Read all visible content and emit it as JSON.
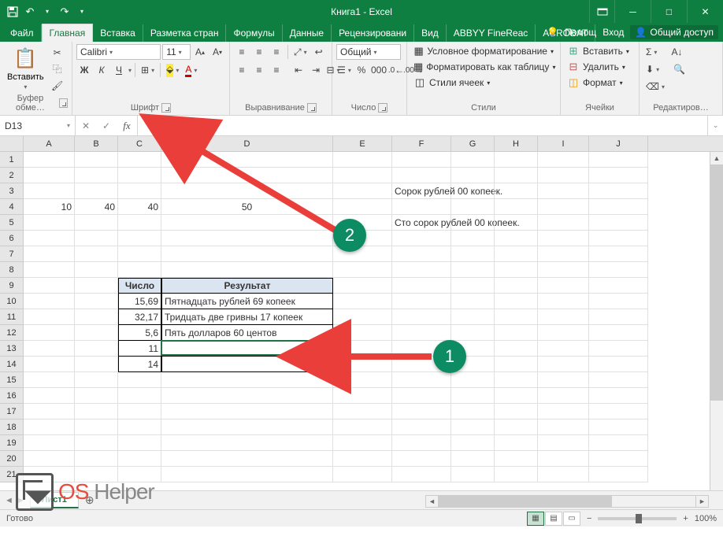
{
  "title": "Книга1 - Excel",
  "qat": {
    "save": "💾",
    "undo": "↶",
    "redo": "↷"
  },
  "tabs": {
    "file": "Файл",
    "list": [
      "Главная",
      "Вставка",
      "Разметка стран",
      "Формулы",
      "Данные",
      "Рецензировани",
      "Вид",
      "ABBYY FineReac",
      "ACROBAT"
    ],
    "active": 0,
    "tell_me": "Помощ",
    "signin": "Вход",
    "share": "Общий доступ"
  },
  "ribbon": {
    "clipboard": {
      "paste": "Вставить",
      "label": "Буфер обме…"
    },
    "font": {
      "name": "Calibri",
      "size": "11",
      "bold": "Ж",
      "italic": "К",
      "underline": "Ч",
      "label": "Шрифт"
    },
    "alignment": {
      "label": "Выравнивание"
    },
    "number": {
      "format": "Общий",
      "label": "Число"
    },
    "styles": {
      "cond": "Условное форматирование",
      "table": "Форматировать как таблицу",
      "cell": "Стили ячеек",
      "label": "Стили"
    },
    "cells": {
      "insert": "Вставить",
      "delete": "Удалить",
      "format": "Формат",
      "label": "Ячейки"
    },
    "editing": {
      "label": "Редактиров…"
    }
  },
  "name_box": "D13",
  "formula": "",
  "columns": [
    "A",
    "B",
    "C",
    "D",
    "E",
    "F",
    "G",
    "H",
    "I",
    "J"
  ],
  "cells": {
    "F3": "Сорок рублей  00 копеек.",
    "A4": "10",
    "B4": "40",
    "C4": "40",
    "D4": "50",
    "F5": "Сто сорок рублей  00 копеек.",
    "C9": "Число",
    "D9": "Результат",
    "C10": "15,69",
    "D10": "Пятнадцать рублей 69 копеек",
    "C11": "32,17",
    "D11": "Тридцать две гривны 17 копеек",
    "C12": "5,6",
    "D12": "Пять долларов 60 центов",
    "C13": "11",
    "C14": "14"
  },
  "sheet": {
    "name": "Лист1"
  },
  "status": {
    "ready": "Готово",
    "zoom": "100%"
  },
  "anno": {
    "one": "1",
    "two": "2"
  },
  "watermark": {
    "os": "OS",
    "helper": " Helper"
  }
}
